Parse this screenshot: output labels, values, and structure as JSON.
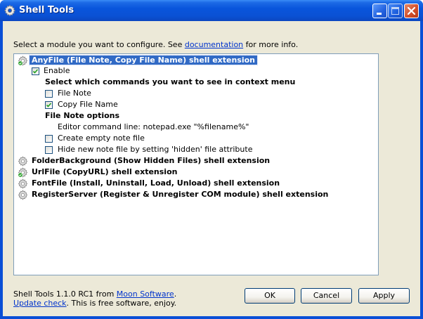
{
  "window": {
    "title": "Shell Tools"
  },
  "prompt": {
    "before": "Select a module you want to configure. See ",
    "link": "documentation",
    "after": " for more info."
  },
  "tree": {
    "anyfile": {
      "label": "AnyFile (File Note, Copy File Name) shell extension",
      "enabled": true
    },
    "enable": {
      "label": "Enable",
      "checked": true
    },
    "commands_heading": "Select which commands you want to see in context menu",
    "file_note": {
      "label": "File Note",
      "checked": false
    },
    "copy_file_name": {
      "label": "Copy File Name",
      "checked": true
    },
    "options_heading": "File Note options",
    "editor_line": "Editor command line: notepad.exe \"%filename%\"",
    "create_empty": {
      "label": "Create empty note file",
      "checked": false
    },
    "hide_note": {
      "label": "Hide new note file by setting 'hidden' file attribute",
      "checked": false
    },
    "folderbg": {
      "label": "FolderBackground (Show Hidden Files) shell extension",
      "enabled": false
    },
    "urlfile": {
      "label": "UrlFile (CopyURL) shell extension",
      "enabled": true
    },
    "fontfile": {
      "label": "FontFile (Install, Uninstall, Load, Unload) shell extension",
      "enabled": false
    },
    "registerserver": {
      "label": "RegisterServer (Register & Unregister COM module) shell extension",
      "enabled": false
    }
  },
  "status": {
    "version": "Shell Tools 1.1.0 RC1 from ",
    "vendor_link": "Moon Software",
    "vendor_after": ".",
    "update_link": "Update check",
    "update_after": ". This is free software, enjoy."
  },
  "buttons": {
    "ok": "OK",
    "cancel": "Cancel",
    "apply": "Apply"
  },
  "colors": {
    "titlebar": "#0a51d4",
    "client": "#ece9d8",
    "selection": "#316ac5",
    "link": "#0033cc",
    "enabled_badge": "#2aa02a"
  }
}
